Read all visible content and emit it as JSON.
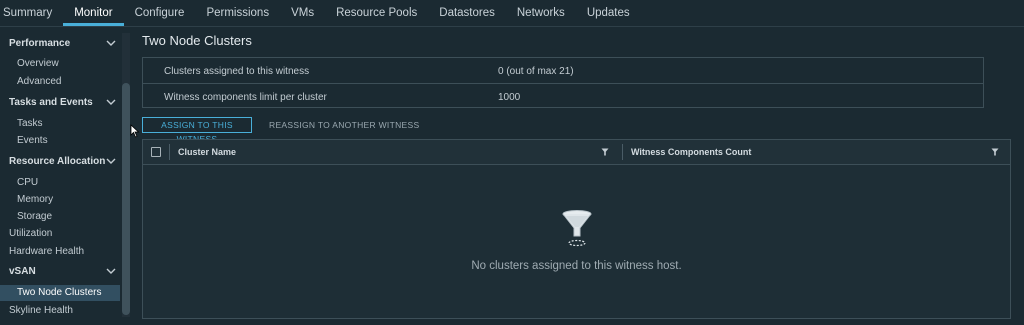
{
  "tabs": [
    "Summary",
    "Monitor",
    "Configure",
    "Permissions",
    "VMs",
    "Resource Pools",
    "Datastores",
    "Networks",
    "Updates"
  ],
  "active_tab": "Monitor",
  "sidebar": {
    "performance": "Performance",
    "overview": "Overview",
    "advanced": "Advanced",
    "tasks_events": "Tasks and Events",
    "tasks": "Tasks",
    "events": "Events",
    "resource_allocation": "Resource Allocation",
    "cpu": "CPU",
    "memory": "Memory",
    "storage": "Storage",
    "utilization": "Utilization",
    "hardware_health": "Hardware Health",
    "vsan": "vSAN",
    "two_node_clusters": "Two Node Clusters",
    "skyline_health": "Skyline Health"
  },
  "main": {
    "title": "Two Node Clusters",
    "info": [
      {
        "label": "Clusters assigned to this witness",
        "value": "0 (out of max 21)"
      },
      {
        "label": "Witness components limit per cluster",
        "value": "1000"
      }
    ],
    "assign_button": "ASSIGN TO THIS WITNESS",
    "reassign_button": "REASSIGN TO ANOTHER WITNESS",
    "columns": [
      "Cluster Name",
      "Witness Components Count"
    ],
    "empty_message": "No clusters assigned to this witness host."
  },
  "colors": {
    "accent": "#49afd9",
    "background": "#1b2a32",
    "selected": "#324f61"
  }
}
